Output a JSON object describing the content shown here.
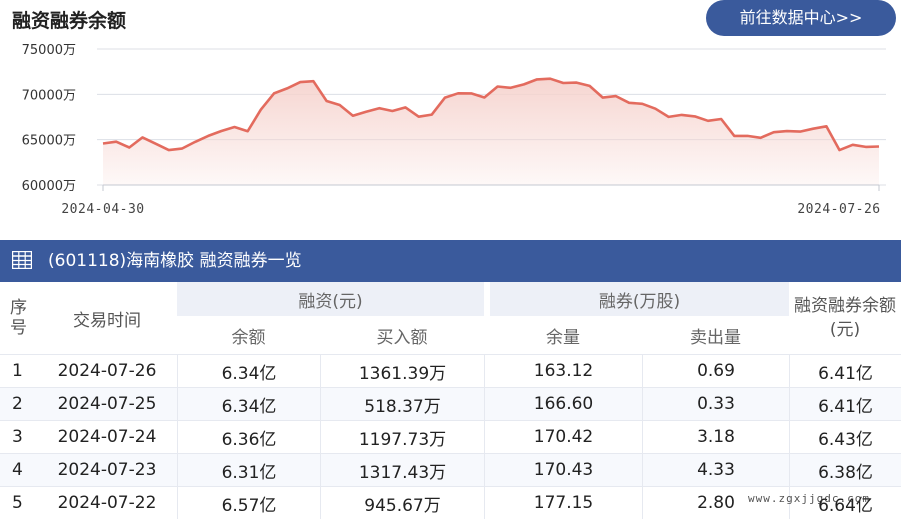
{
  "header": {
    "title": "融资融券余额",
    "link_label": "前往数据中心>>"
  },
  "chart_data": {
    "type": "area",
    "ylim": [
      60000,
      75000
    ],
    "y_ticks": [
      "75000万",
      "70000万",
      "65000万",
      "60000万"
    ],
    "y_tick_values": [
      75000,
      70000,
      65000,
      60000
    ],
    "x_labels": [
      "2024-04-30",
      "2024-07-26"
    ],
    "line_color": "#e36b5e",
    "fill_color": "#f6d3ce",
    "series": [
      {
        "values": [
          64580,
          64780,
          64140,
          65250,
          64560,
          63850,
          64020,
          64750,
          65420,
          65960,
          66400,
          65930,
          68300,
          70100,
          70650,
          71350,
          71450,
          69270,
          68820,
          67640,
          68090,
          68470,
          68160,
          68560,
          67530,
          67760,
          69640,
          70110,
          70100,
          69650,
          70860,
          70720,
          71100,
          71650,
          71720,
          71250,
          71290,
          70930,
          69640,
          69810,
          69070,
          68960,
          68410,
          67510,
          67730,
          67570,
          67080,
          67280,
          65420,
          65420,
          65210,
          65820,
          65940,
          65890,
          66210,
          66470,
          63850,
          64430,
          64200,
          64250
        ]
      }
    ]
  },
  "table": {
    "title": "(601118)海南橡胶 融资融券一览",
    "headers": {
      "index": "序号",
      "date": "交易时间",
      "financing": "融资(元)",
      "financing_balance": "余额",
      "financing_buy": "买入额",
      "securities": "融券(万股)",
      "securities_remaining": "余量",
      "securities_sell": "卖出量",
      "total": "融资融券余额(元)"
    },
    "rows": [
      {
        "idx": "1",
        "date": "2024-07-26",
        "fin_bal": "6.34亿",
        "fin_buy": "1361.39万",
        "sec_rem": "163.12",
        "sec_sell": "0.69",
        "total": "6.41亿"
      },
      {
        "idx": "2",
        "date": "2024-07-25",
        "fin_bal": "6.34亿",
        "fin_buy": "518.37万",
        "sec_rem": "166.60",
        "sec_sell": "0.33",
        "total": "6.41亿"
      },
      {
        "idx": "3",
        "date": "2024-07-24",
        "fin_bal": "6.36亿",
        "fin_buy": "1197.73万",
        "sec_rem": "170.42",
        "sec_sell": "3.18",
        "total": "6.43亿"
      },
      {
        "idx": "4",
        "date": "2024-07-23",
        "fin_bal": "6.31亿",
        "fin_buy": "1317.43万",
        "sec_rem": "170.43",
        "sec_sell": "4.33",
        "total": "6.38亿"
      },
      {
        "idx": "5",
        "date": "2024-07-22",
        "fin_bal": "6.57亿",
        "fin_buy": "945.67万",
        "sec_rem": "177.15",
        "sec_sell": "2.80",
        "total": "6.64亿"
      }
    ]
  },
  "watermark": "www.zgxjjgdc.com"
}
